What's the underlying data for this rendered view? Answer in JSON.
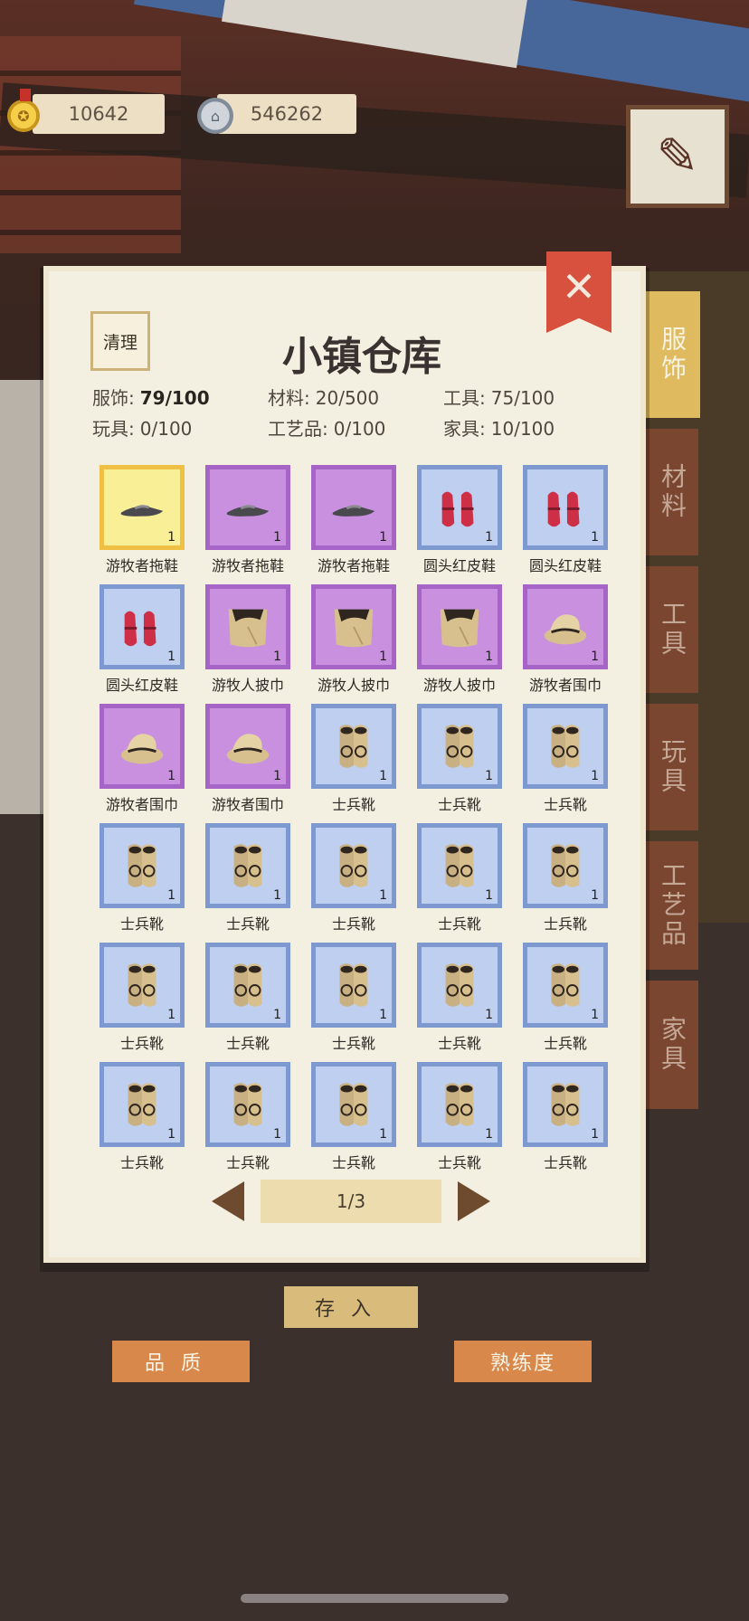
{
  "currency": {
    "gold": "10642",
    "silver": "546262"
  },
  "panel": {
    "title": "小镇仓库",
    "clean_label": "清理",
    "close_label": "✕"
  },
  "stats": [
    {
      "label": "服饰:",
      "value": "79/100",
      "bold": true
    },
    {
      "label": "材料:",
      "value": "20/500"
    },
    {
      "label": "工具:",
      "value": "75/100"
    },
    {
      "label": "玩具:",
      "value": "0/100"
    },
    {
      "label": "工艺品:",
      "value": "0/100"
    },
    {
      "label": "家具:",
      "value": "10/100"
    }
  ],
  "items": [
    {
      "name": "游牧者拖鞋",
      "qty": "1",
      "rarity": "yellow",
      "icon": "slipper-icon"
    },
    {
      "name": "游牧者拖鞋",
      "qty": "1",
      "rarity": "purple",
      "icon": "slipper-icon"
    },
    {
      "name": "游牧者拖鞋",
      "qty": "1",
      "rarity": "purple",
      "icon": "slipper-icon"
    },
    {
      "name": "圆头红皮鞋",
      "qty": "1",
      "rarity": "blue",
      "icon": "red-shoes-icon"
    },
    {
      "name": "圆头红皮鞋",
      "qty": "1",
      "rarity": "blue",
      "icon": "red-shoes-icon"
    },
    {
      "name": "圆头红皮鞋",
      "qty": "1",
      "rarity": "blue",
      "icon": "red-shoes-icon"
    },
    {
      "name": "游牧人披巾",
      "qty": "1",
      "rarity": "purple",
      "icon": "shawl-icon"
    },
    {
      "name": "游牧人披巾",
      "qty": "1",
      "rarity": "purple",
      "icon": "shawl-icon"
    },
    {
      "name": "游牧人披巾",
      "qty": "1",
      "rarity": "purple",
      "icon": "shawl-icon"
    },
    {
      "name": "游牧者围巾",
      "qty": "1",
      "rarity": "purple",
      "icon": "scarf-icon"
    },
    {
      "name": "游牧者围巾",
      "qty": "1",
      "rarity": "purple",
      "icon": "scarf-icon"
    },
    {
      "name": "游牧者围巾",
      "qty": "1",
      "rarity": "purple",
      "icon": "scarf-icon"
    },
    {
      "name": "士兵靴",
      "qty": "1",
      "rarity": "blue",
      "icon": "boots-icon"
    },
    {
      "name": "士兵靴",
      "qty": "1",
      "rarity": "blue",
      "icon": "boots-icon"
    },
    {
      "name": "士兵靴",
      "qty": "1",
      "rarity": "blue",
      "icon": "boots-icon"
    },
    {
      "name": "士兵靴",
      "qty": "1",
      "rarity": "blue",
      "icon": "boots-icon"
    },
    {
      "name": "士兵靴",
      "qty": "1",
      "rarity": "blue",
      "icon": "boots-icon"
    },
    {
      "name": "士兵靴",
      "qty": "1",
      "rarity": "blue",
      "icon": "boots-icon"
    },
    {
      "name": "士兵靴",
      "qty": "1",
      "rarity": "blue",
      "icon": "boots-icon"
    },
    {
      "name": "士兵靴",
      "qty": "1",
      "rarity": "blue",
      "icon": "boots-icon"
    },
    {
      "name": "士兵靴",
      "qty": "1",
      "rarity": "blue",
      "icon": "boots-icon"
    },
    {
      "name": "士兵靴",
      "qty": "1",
      "rarity": "blue",
      "icon": "boots-icon"
    },
    {
      "name": "士兵靴",
      "qty": "1",
      "rarity": "blue",
      "icon": "boots-icon"
    },
    {
      "name": "士兵靴",
      "qty": "1",
      "rarity": "blue",
      "icon": "boots-icon"
    },
    {
      "name": "士兵靴",
      "qty": "1",
      "rarity": "blue",
      "icon": "boots-icon"
    },
    {
      "name": "士兵靴",
      "qty": "1",
      "rarity": "blue",
      "icon": "boots-icon"
    },
    {
      "name": "士兵靴",
      "qty": "1",
      "rarity": "blue",
      "icon": "boots-icon"
    },
    {
      "name": "士兵靴",
      "qty": "1",
      "rarity": "blue",
      "icon": "boots-icon"
    },
    {
      "name": "士兵靴",
      "qty": "1",
      "rarity": "blue",
      "icon": "boots-icon"
    },
    {
      "name": "士兵靴",
      "qty": "1",
      "rarity": "blue",
      "icon": "boots-icon"
    }
  ],
  "tabs": [
    {
      "label": "服饰",
      "active": true
    },
    {
      "label": "材料",
      "active": false
    },
    {
      "label": "工具",
      "active": false
    },
    {
      "label": "玩具",
      "active": false
    },
    {
      "label": "工艺品",
      "active": false
    },
    {
      "label": "家具",
      "active": false
    }
  ],
  "pager": {
    "label": "1/3"
  },
  "buttons": {
    "deposit": "存入",
    "quality": "品质",
    "skill": "熟练度"
  }
}
